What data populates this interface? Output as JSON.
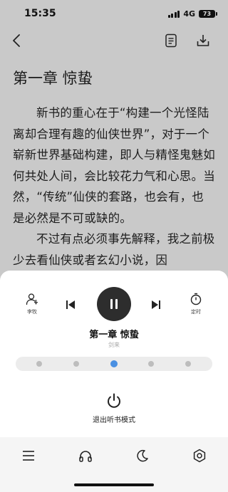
{
  "status": {
    "time": "15:35",
    "network": "4G",
    "battery": "73"
  },
  "reader": {
    "chapter_title": "第一章 惊蛰",
    "paragraphs": [
      "新书的重心在于“构建一个光怪陆离却合理有趣的仙侠世界”，对于一个崭新世界基础构建，即人与精怪鬼魅如何共处人间，会比较花力气和心思。当然，“传统”仙侠的套路，也会有，也是必然是不可或缺的。",
      "不过有点必须事先解释，我之前极少去看仙侠或者玄幻小说，因"
    ]
  },
  "player": {
    "voice_label": "李牧",
    "timer_label": "定时",
    "title": "第一章 惊蛰",
    "author": "剑来",
    "speed_levels": 5,
    "speed_selected_index": 2,
    "exit_label": "退出听书模式"
  },
  "colors": {
    "accent": "#4a90e2",
    "play_bg": "#2d2d2d",
    "reader_bg": "#c9c9c9"
  }
}
